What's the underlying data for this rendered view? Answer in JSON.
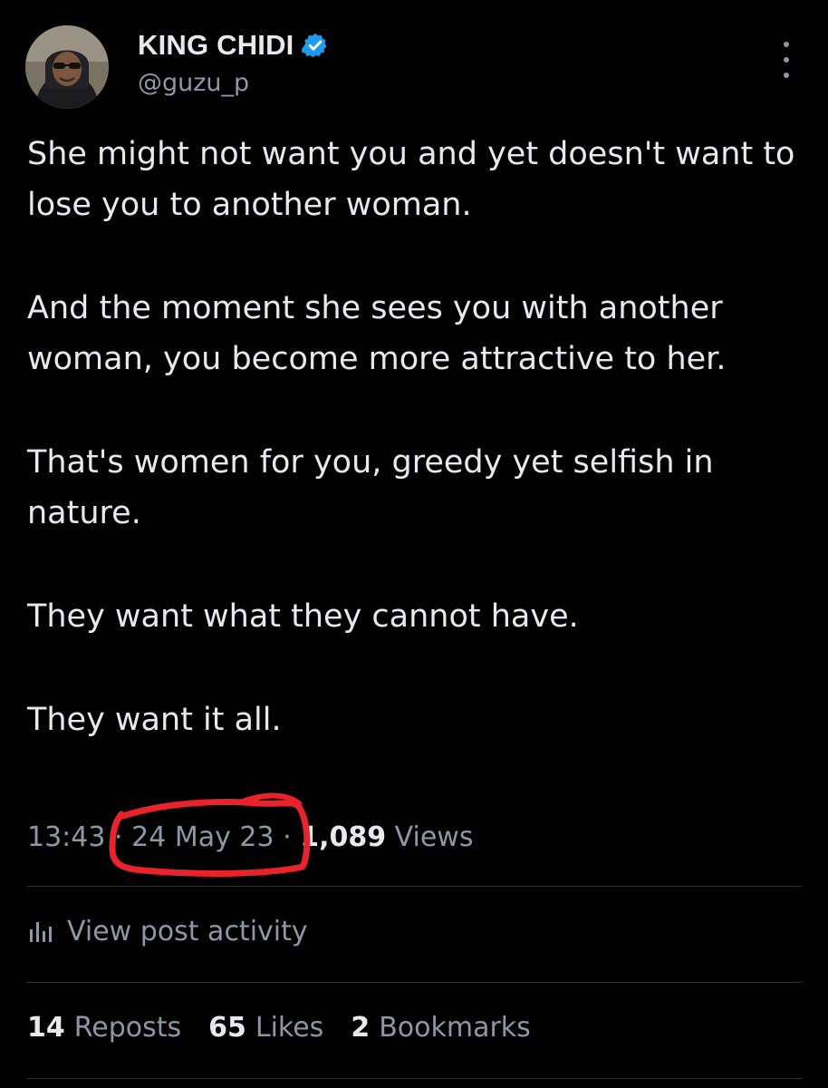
{
  "author": {
    "display_name": "KING CHIDI",
    "handle": "@guzu_p",
    "verified": true,
    "verified_color": "#1d9bf0",
    "avatar_icon": "avatar-photo"
  },
  "more_icon": "more-vertical-icon",
  "tweet": {
    "paragraphs": [
      "She might not want you and yet doesn't want to lose you to another woman.",
      "And the moment she sees you with another woman, you become more attractive to her.",
      "That's women for you, greedy yet selfish in nature.",
      "They want what they cannot have.",
      "They want it all."
    ]
  },
  "meta": {
    "time": "13:43",
    "date": "24 May 23",
    "separator": "·",
    "views_count": "1,089",
    "views_label": "Views",
    "annotation_color": "#e8232b"
  },
  "activity": {
    "icon": "analytics-bars-icon",
    "label": "View post activity"
  },
  "stats": {
    "reposts_count": "14",
    "reposts_label": "Reposts",
    "likes_count": "65",
    "likes_label": "Likes",
    "bookmarks_count": "2",
    "bookmarks_label": "Bookmarks"
  }
}
